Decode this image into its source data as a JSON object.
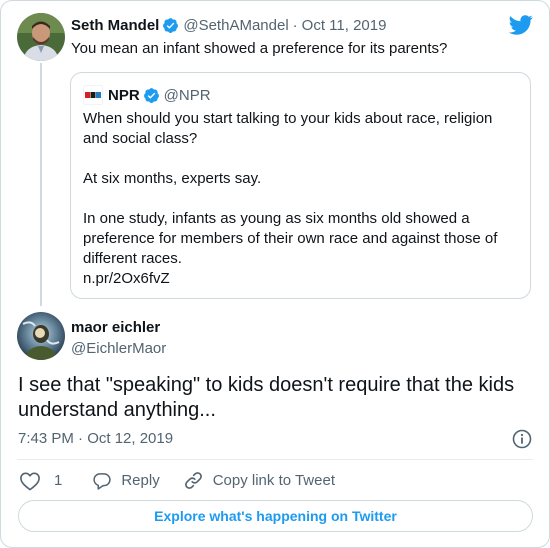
{
  "colors": {
    "twitter_blue": "#1d9bf0",
    "text_primary": "#0f1419",
    "text_secondary": "#536471",
    "border": "#cfd9de",
    "like_icon": "#536471"
  },
  "icons": [
    "twitter-logo-icon",
    "verified-badge-icon",
    "npr-logo-icon",
    "info-icon",
    "heart-icon",
    "reply-icon",
    "link-icon"
  ],
  "parent_tweet": {
    "author_name": "Seth Mandel",
    "author_handle": "@SethAMandel",
    "separator": "·",
    "date": "Oct 11, 2019",
    "text": "You mean an infant showed a preference for its parents?"
  },
  "quoted_tweet": {
    "author_name": "NPR",
    "author_handle": "@NPR",
    "paragraphs": [
      [
        "When should you start talking to your kids about race, religion",
        "and social class?"
      ],
      [
        "At six months, experts say."
      ],
      [
        "In one study, infants as young as six months old showed a",
        "preference for members of their own race and against those of",
        "different races.",
        "n.pr/2Ox6fvZ"
      ]
    ]
  },
  "reply_tweet": {
    "author_name": "maor eichler",
    "author_handle": "@EichlerMaor",
    "text_lines": [
      "I see that \"speaking\" to kids doesn't require that the kids",
      "understand anything..."
    ],
    "timestamp": "7:43 PM · Oct 12, 2019"
  },
  "actions": {
    "like_count": "1",
    "reply_label": "Reply",
    "copy_link_label": "Copy link to Tweet"
  },
  "explore_button": "Explore what's happening on Twitter"
}
